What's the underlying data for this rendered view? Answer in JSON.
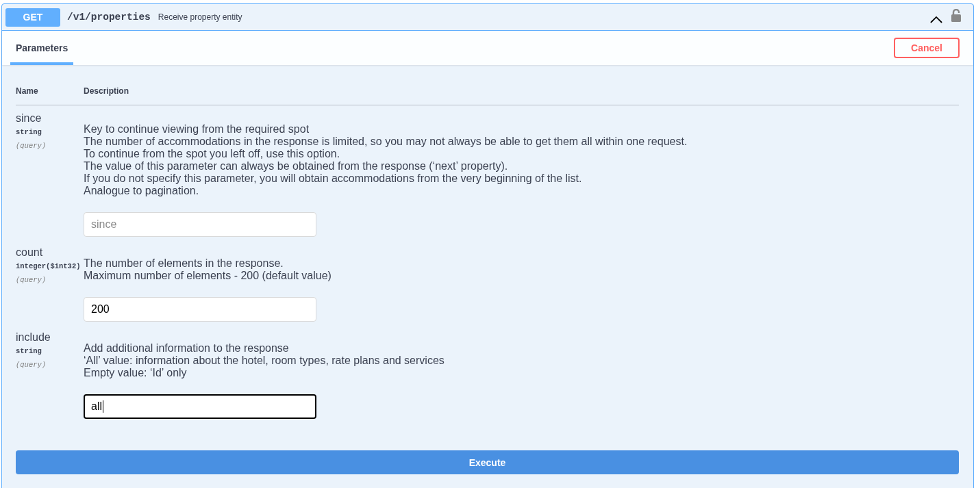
{
  "operation": {
    "method": "GET",
    "path": "/v1/properties",
    "summary": "Receive property entity",
    "expanded": true,
    "locked": false
  },
  "tabs": [
    {
      "label": "Parameters",
      "selected": true
    }
  ],
  "cancel_button": {
    "label": "Cancel"
  },
  "table": {
    "columns": [
      "Name",
      "Description"
    ],
    "rows": [
      {
        "name": "since",
        "type": "string",
        "location": "(query)",
        "description": [
          "Key to continue viewing from the required spot",
          "The number of accommodations in the response is limited, so you may not always be able to get them all within one request.",
          "To continue from the spot you left off, use this option.",
          "The value of this parameter can always be obtained from the response (‘next’ property).",
          "If you do not specify this parameter, you will obtain accommodations from the very beginning of the list.",
          "Analogue to pagination."
        ],
        "input": {
          "placeholder": "since",
          "focused": false
        }
      },
      {
        "name": "count",
        "type": "integer($int32)",
        "location": "(query)",
        "description": [
          "The number of elements in the response.",
          "Maximum number of elements - 200 (default value)"
        ],
        "input": {
          "value": "200",
          "focused": false
        }
      },
      {
        "name": "include",
        "type": "string",
        "location": "(query)",
        "description": [
          "Add additional information to the response",
          "‘All’ value: information about the hotel, room types, rate plans and services",
          "Empty value: ‘Id’ only"
        ],
        "input": {
          "value": "all",
          "focused": true
        }
      }
    ]
  },
  "execute_button": {
    "label": "Execute"
  }
}
